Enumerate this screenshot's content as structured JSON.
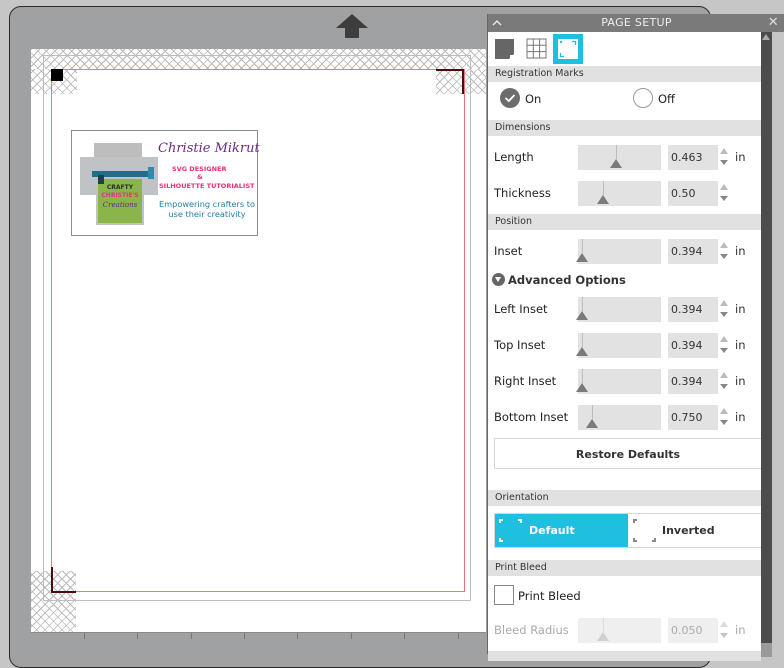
{
  "canvas": {
    "card": {
      "name": "Christie Mikrut",
      "subtitle_1": "SVG DESIGNER",
      "ampersand": "&",
      "subtitle_2": "SILHOUETTE TUTORIALIST",
      "tagline": "Empowering crafters to use their creativity",
      "paper_line_1": "CRAFTY",
      "paper_line_2": "CHRISTIE'S",
      "paper_line_3": "Creations"
    }
  },
  "panel": {
    "title": "PAGE SETUP",
    "collapse_glyph": "^",
    "close_glyph": "✕",
    "tabs": [
      {
        "name": "media",
        "icon": "page-icon",
        "active": false
      },
      {
        "name": "grid",
        "icon": "grid-icon",
        "active": false
      },
      {
        "name": "registration",
        "icon": "registration-marks-icon",
        "active": true
      }
    ],
    "registration_marks": {
      "header": "Registration Marks",
      "options": [
        {
          "label": "On",
          "selected": true
        },
        {
          "label": "Off",
          "selected": false
        }
      ]
    },
    "dimensions": {
      "header": "Dimensions",
      "fields": [
        {
          "label": "Length",
          "value": "0.463",
          "unit": "in"
        },
        {
          "label": "Thickness",
          "value": "0.50",
          "unit": ""
        }
      ]
    },
    "position": {
      "header": "Position",
      "fields": [
        {
          "label": "Inset",
          "value": "0.394",
          "unit": "in"
        }
      ]
    },
    "advanced": {
      "label": "Advanced Options",
      "expanded": true,
      "fields": [
        {
          "label": "Left Inset",
          "value": "0.394",
          "unit": "in"
        },
        {
          "label": "Top Inset",
          "value": "0.394",
          "unit": "in"
        },
        {
          "label": "Right Inset",
          "value": "0.394",
          "unit": "in"
        },
        {
          "label": "Bottom Inset",
          "value": "0.750",
          "unit": "in"
        }
      ]
    },
    "restore_defaults_label": "Restore Defaults",
    "orientation": {
      "header": "Orientation",
      "options": [
        {
          "label": "Default",
          "selected": true
        },
        {
          "label": "Inverted",
          "selected": false
        }
      ]
    },
    "print_bleed": {
      "header": "Print Bleed",
      "checkbox_label": "Print Bleed",
      "checked": false,
      "radius_label": "Bleed Radius",
      "radius_value": "0.050",
      "radius_unit": "in"
    },
    "accent_color": "#1fbfdf"
  }
}
